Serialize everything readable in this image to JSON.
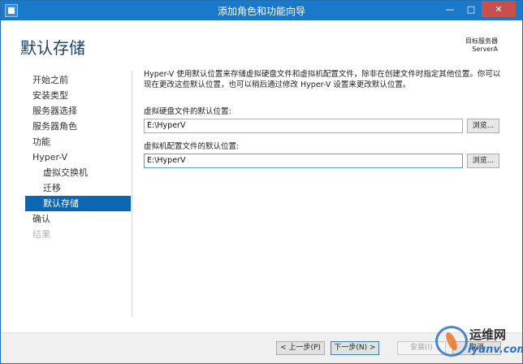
{
  "window": {
    "title": "添加角色和功能向导",
    "minimize_glyph": "—",
    "maximize_glyph": "□",
    "close_glyph": "✕"
  },
  "header": {
    "page_title": "默认存储",
    "target_server_label": "目标服务器",
    "target_server_value": "ServerA"
  },
  "nav": {
    "items": [
      {
        "label": "开始之前",
        "state": "normal"
      },
      {
        "label": "安装类型",
        "state": "normal"
      },
      {
        "label": "服务器选择",
        "state": "normal"
      },
      {
        "label": "服务器角色",
        "state": "normal"
      },
      {
        "label": "功能",
        "state": "normal"
      },
      {
        "label": "Hyper-V",
        "state": "normal"
      },
      {
        "label": "虚拟交换机",
        "state": "sub"
      },
      {
        "label": "迁移",
        "state": "sub"
      },
      {
        "label": "默认存储",
        "state": "selected"
      },
      {
        "label": "确认",
        "state": "normal"
      },
      {
        "label": "结果",
        "state": "disabled"
      }
    ]
  },
  "main": {
    "description": "Hyper-V 使用默认位置来存储虚拟硬盘文件和虚拟机配置文件，除非在创建文件时指定其他位置。你可以现在更改这些默认位置，也可以稍后通过修改 Hyper-V 设置来更改默认位置。",
    "vhd_label": "虚拟硬盘文件的默认位置:",
    "vhd_value": "E:\\HyperV",
    "vm_config_label": "虚拟机配置文件的默认位置:",
    "vm_config_value": "E:\\HyperV",
    "browse_label": "浏览..."
  },
  "footer": {
    "prev_label": "< 上一步(P)",
    "next_label": "下一步(N) >",
    "install_label": "安装(I)",
    "cancel_label": "取消"
  },
  "watermark": {
    "line1": "运维网",
    "line2": "iyunv.com"
  },
  "colors": {
    "titlebar": "#1979ca",
    "selected_nav": "#0b67b1",
    "page_title": "#1e3f66"
  }
}
